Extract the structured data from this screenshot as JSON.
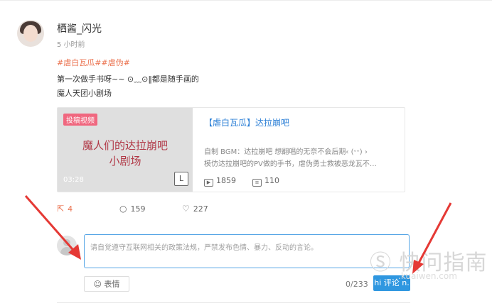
{
  "user": {
    "name": "栖酱_闪光",
    "time": "5 小时前",
    "avatar_dots": "..."
  },
  "post": {
    "tags": "#虐白瓦瓜##虐伪#",
    "line1": "第一次做手书呀~~ ⊙﹏⊙‖都是随手画的",
    "line2": "魔人天团小剧场"
  },
  "card": {
    "badge": "投稿视频",
    "thumb_title_line1": "魔人们的达拉崩吧",
    "thumb_title_line2": "小剧场",
    "duration": "03:28",
    "title": "【虐白瓦瓜】达拉崩吧",
    "desc_line1": "自制 BGM：达拉崩吧 想翻唱的无奈不会后期‹ (ᵕᵕ) ›",
    "desc_line2": "模仿达拉崩吧的PV做的手书，虐伪勇士救被恶龙瓦不…",
    "plays": "1859",
    "danmaku": "110"
  },
  "actions": {
    "share": "4",
    "comment": "159",
    "like": "227"
  },
  "comment": {
    "placeholder": "请自觉遵守互联网相关的政策法规，严禁发布色情、暴力、反动的言论。",
    "emoji_label": "表情",
    "counter": "0/233",
    "submit": "hi 评论 n."
  },
  "watermark": {
    "text": "Ⓢ 快问指南",
    "sub": ".kuaiwen.com"
  },
  "colors": {
    "accent_orange": "#eb7350",
    "link_blue": "#2b7fd6",
    "submit_blue": "#2f97e0",
    "badge_pink": "#f0677f",
    "arrow_red": "#e53935"
  }
}
